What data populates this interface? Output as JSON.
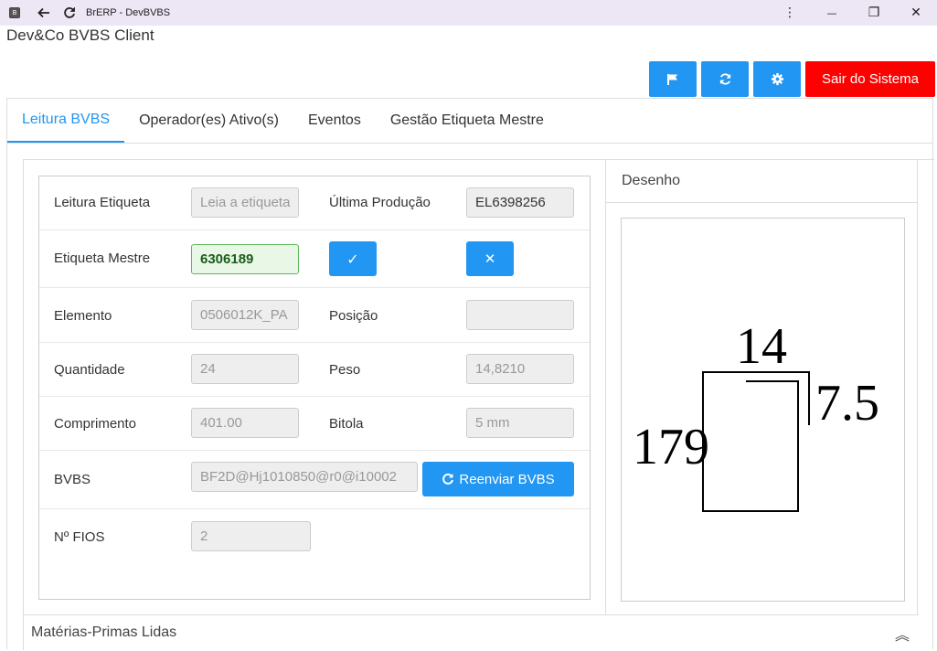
{
  "window": {
    "app_icon_letter": "B",
    "title": "BrERP - DevBVBS",
    "menu_icon": "⋮",
    "minimize_icon": "—",
    "restore_icon": "❐",
    "close_icon": "✕"
  },
  "app_title": "Dev&Co BVBS Client",
  "toolbar": {
    "flag_icon": "flag-icon",
    "refresh_icon": "refresh-icon",
    "settings_icon": "gear-icon",
    "exit_label": "Sair do Sistema",
    "accent_color": "#2196f3",
    "exit_color": "#ff0000"
  },
  "tabs": [
    {
      "label": "Leitura BVBS",
      "active": true
    },
    {
      "label": "Operador(es) Ativo(s)",
      "active": false
    },
    {
      "label": "Eventos",
      "active": false
    },
    {
      "label": "Gestão Etiqueta Mestre",
      "active": false
    }
  ],
  "form": {
    "leitura_etiqueta": {
      "label": "Leitura Etiqueta",
      "placeholder": "Leia a etiqueta"
    },
    "ultima_producao": {
      "label": "Última Produção",
      "value": "EL6398256"
    },
    "etiqueta_mestre": {
      "label": "Etiqueta Mestre",
      "value": "6306189"
    },
    "confirm_icon": "✓",
    "cancel_icon": "✕",
    "elemento": {
      "label": "Elemento",
      "value": "0506012K_PA"
    },
    "posicao": {
      "label": "Posição",
      "value": ""
    },
    "quantidade": {
      "label": "Quantidade",
      "value": "24"
    },
    "peso": {
      "label": "Peso",
      "value": "14,8210"
    },
    "comprimento": {
      "label": "Comprimento",
      "value": "401.00"
    },
    "bitola": {
      "label": "Bitola",
      "value": "5 mm"
    },
    "bvbs": {
      "label": "BVBS",
      "value": "BF2D@Hj1010850@r0@i10002"
    },
    "reenviar_label": "Reenviar BVBS",
    "n_fios": {
      "label": "Nº FIOS",
      "value": "2"
    }
  },
  "drawing": {
    "header": "Desenho",
    "dim_top": "14",
    "dim_right": "7.5",
    "dim_left": "179"
  },
  "materias_primas": {
    "title": "Matérias-Primas Lidas",
    "chevron": "︽"
  }
}
